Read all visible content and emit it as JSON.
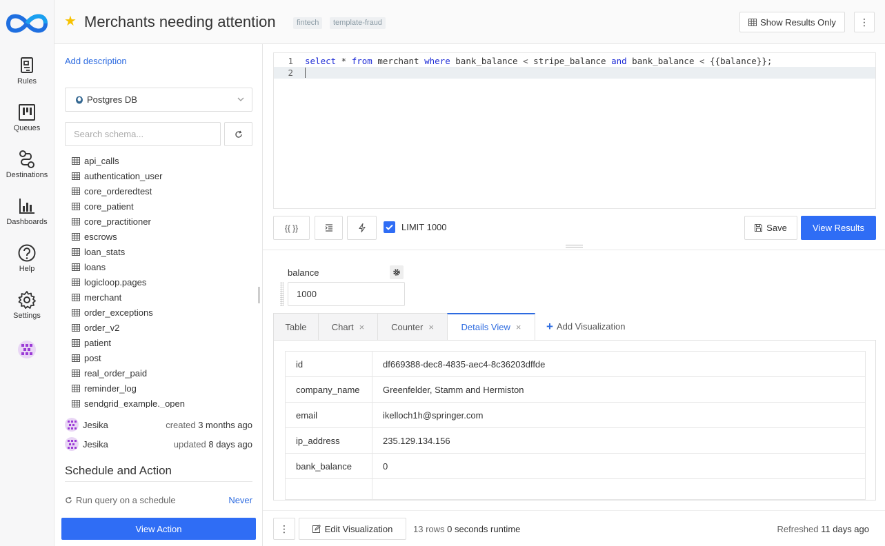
{
  "nav": {
    "items": [
      {
        "label": "Rules",
        "icon": "rules-icon"
      },
      {
        "label": "Queues",
        "icon": "queues-icon"
      },
      {
        "label": "Destinations",
        "icon": "destinations-icon"
      },
      {
        "label": "Dashboards",
        "icon": "dashboards-icon"
      },
      {
        "label": "Help",
        "icon": "help-icon"
      },
      {
        "label": "Settings",
        "icon": "gear-icon"
      }
    ]
  },
  "header": {
    "title": "Merchants needing attention",
    "tags": [
      "fintech",
      "template-fraud"
    ],
    "show_results_label": "Show Results Only"
  },
  "sidebar": {
    "add_description": "Add description",
    "datasource": "Postgres DB",
    "search_placeholder": "Search schema...",
    "schema": [
      "api_calls",
      "authentication_user",
      "core_orderedtest",
      "core_patient",
      "core_practitioner",
      "escrows",
      "loan_stats",
      "loans",
      "logicloop.pages",
      "merchant",
      "order_exceptions",
      "order_v2",
      "patient",
      "post",
      "real_order_paid",
      "reminder_log",
      "sendgrid_example._open"
    ],
    "created": {
      "user": "Jesika",
      "prefix": "created",
      "when": "3 months ago"
    },
    "updated": {
      "user": "Jesika",
      "prefix": "updated",
      "when": "8 days ago"
    },
    "schedule_title": "Schedule and Action",
    "schedule_label": "Run query on a schedule",
    "schedule_value": "Never",
    "view_action_label": "View Action"
  },
  "editor": {
    "line_numbers": [
      "1",
      "2"
    ],
    "query_tokens": {
      "select": "select",
      "star": " * ",
      "from": "from",
      "table": " merchant ",
      "where": "where",
      "cond1": " bank_balance ",
      "lt1": "<",
      "cond2": " stripe_balance ",
      "and": "and",
      "cond3": " bank_balance ",
      "lt2": "<",
      "param": " {{balance}};"
    }
  },
  "toolbar": {
    "param_btn": "{{ }}",
    "limit_label": "LIMIT 1000",
    "limit_checked": true,
    "save_label": "Save",
    "view_results_label": "View Results"
  },
  "parameter": {
    "name": "balance",
    "value": "1000"
  },
  "tabs": [
    {
      "label": "Table",
      "closable": false
    },
    {
      "label": "Chart",
      "closable": true
    },
    {
      "label": "Counter",
      "closable": true
    },
    {
      "label": "Details View",
      "closable": true,
      "active": true
    }
  ],
  "add_visualization_label": "Add Visualization",
  "details": [
    {
      "key": "id",
      "value": "df669388-dec8-4835-aec4-8c36203dffde"
    },
    {
      "key": "company_name",
      "value": "Greenfelder, Stamm and Hermiston"
    },
    {
      "key": "email",
      "value": "ikelloch1h@springer.com"
    },
    {
      "key": "ip_address",
      "value": "235.129.134.156"
    },
    {
      "key": "bank_balance",
      "value": "0"
    }
  ],
  "footer": {
    "edit_viz_label": "Edit Visualization",
    "rows_count": "13 rows",
    "runtime": "0 seconds runtime",
    "refreshed_prefix": "Refreshed",
    "refreshed_when": "11 days ago"
  },
  "colors": {
    "accent": "#2f6df5",
    "star": "#f7c200",
    "keyword": "#1d2bd6"
  }
}
